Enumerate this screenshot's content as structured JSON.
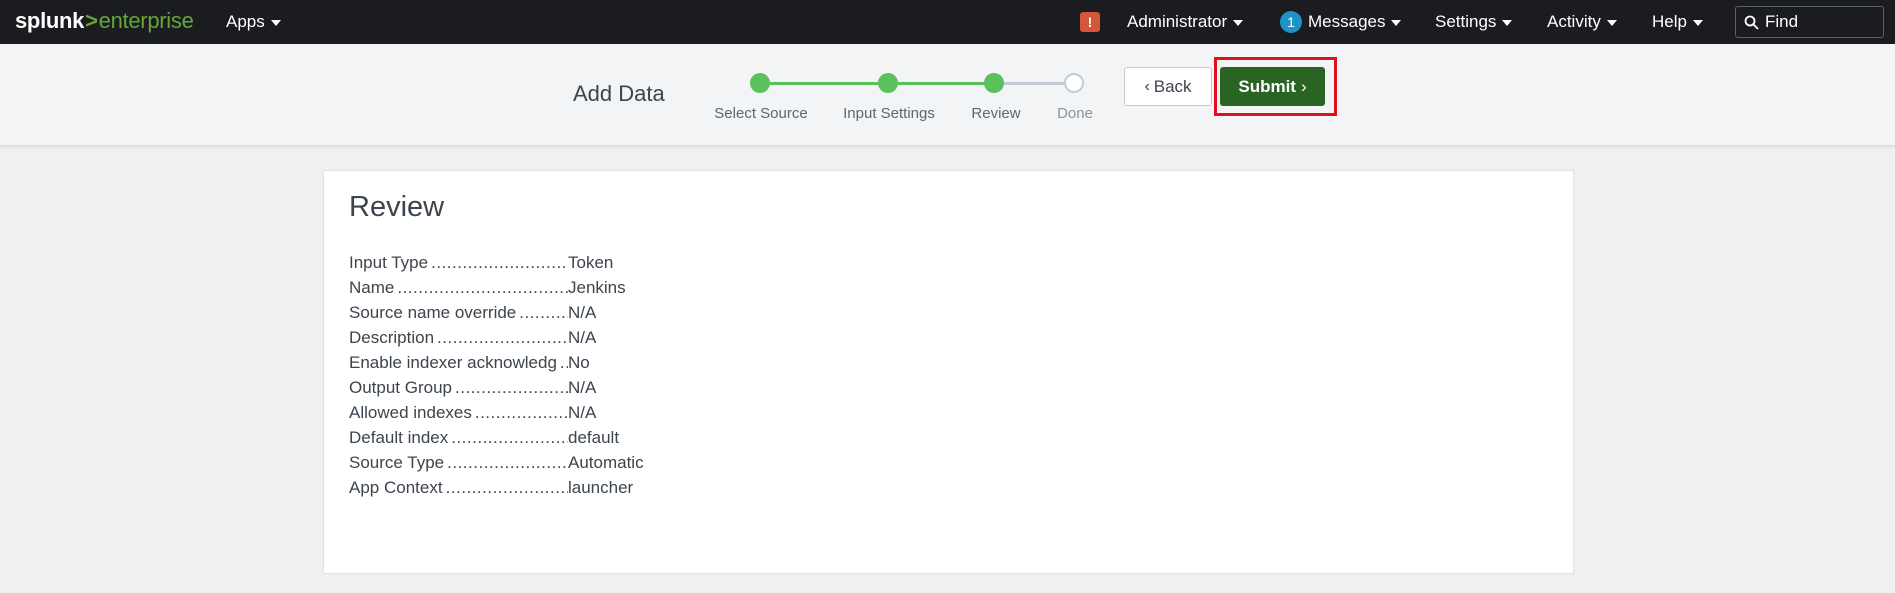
{
  "topbar": {
    "logo_splunk": "splunk",
    "logo_gt": ">",
    "logo_enterprise": "enterprise",
    "apps_label": "Apps",
    "alert_icon": "!",
    "user_label": "Administrator",
    "messages_count": "1",
    "messages_label": "Messages",
    "settings_label": "Settings",
    "activity_label": "Activity",
    "help_label": "Help",
    "find_placeholder": "Find"
  },
  "wizard": {
    "title": "Add Data",
    "steps": [
      {
        "label": "Select Source",
        "status": "complete"
      },
      {
        "label": "Input Settings",
        "status": "complete"
      },
      {
        "label": "Review",
        "status": "current"
      },
      {
        "label": "Done",
        "status": "pending"
      }
    ],
    "back_label": "Back",
    "submit_label": "Submit"
  },
  "review": {
    "title": "Review",
    "rows": [
      {
        "key": "Input Type",
        "value": "Token"
      },
      {
        "key": "Name",
        "value": "Jenkins"
      },
      {
        "key": "Source name override",
        "value": "N/A"
      },
      {
        "key": "Description",
        "value": "N/A"
      },
      {
        "key": "Enable indexer acknowledg",
        "value": "No"
      },
      {
        "key": "Output Group",
        "value": "N/A"
      },
      {
        "key": "Allowed indexes",
        "value": "N/A"
      },
      {
        "key": "Default index",
        "value": "default"
      },
      {
        "key": "Source Type",
        "value": "Automatic"
      },
      {
        "key": "App Context",
        "value": "launcher"
      }
    ]
  },
  "colors": {
    "topbar_bg": "#1a1c20",
    "brand_green": "#65a637",
    "step_complete": "#5cc05c",
    "submit_bg": "#2a6422",
    "highlight": "#e0101f",
    "messages_badge": "#1e93c6",
    "alert_badge": "#d6563c"
  }
}
